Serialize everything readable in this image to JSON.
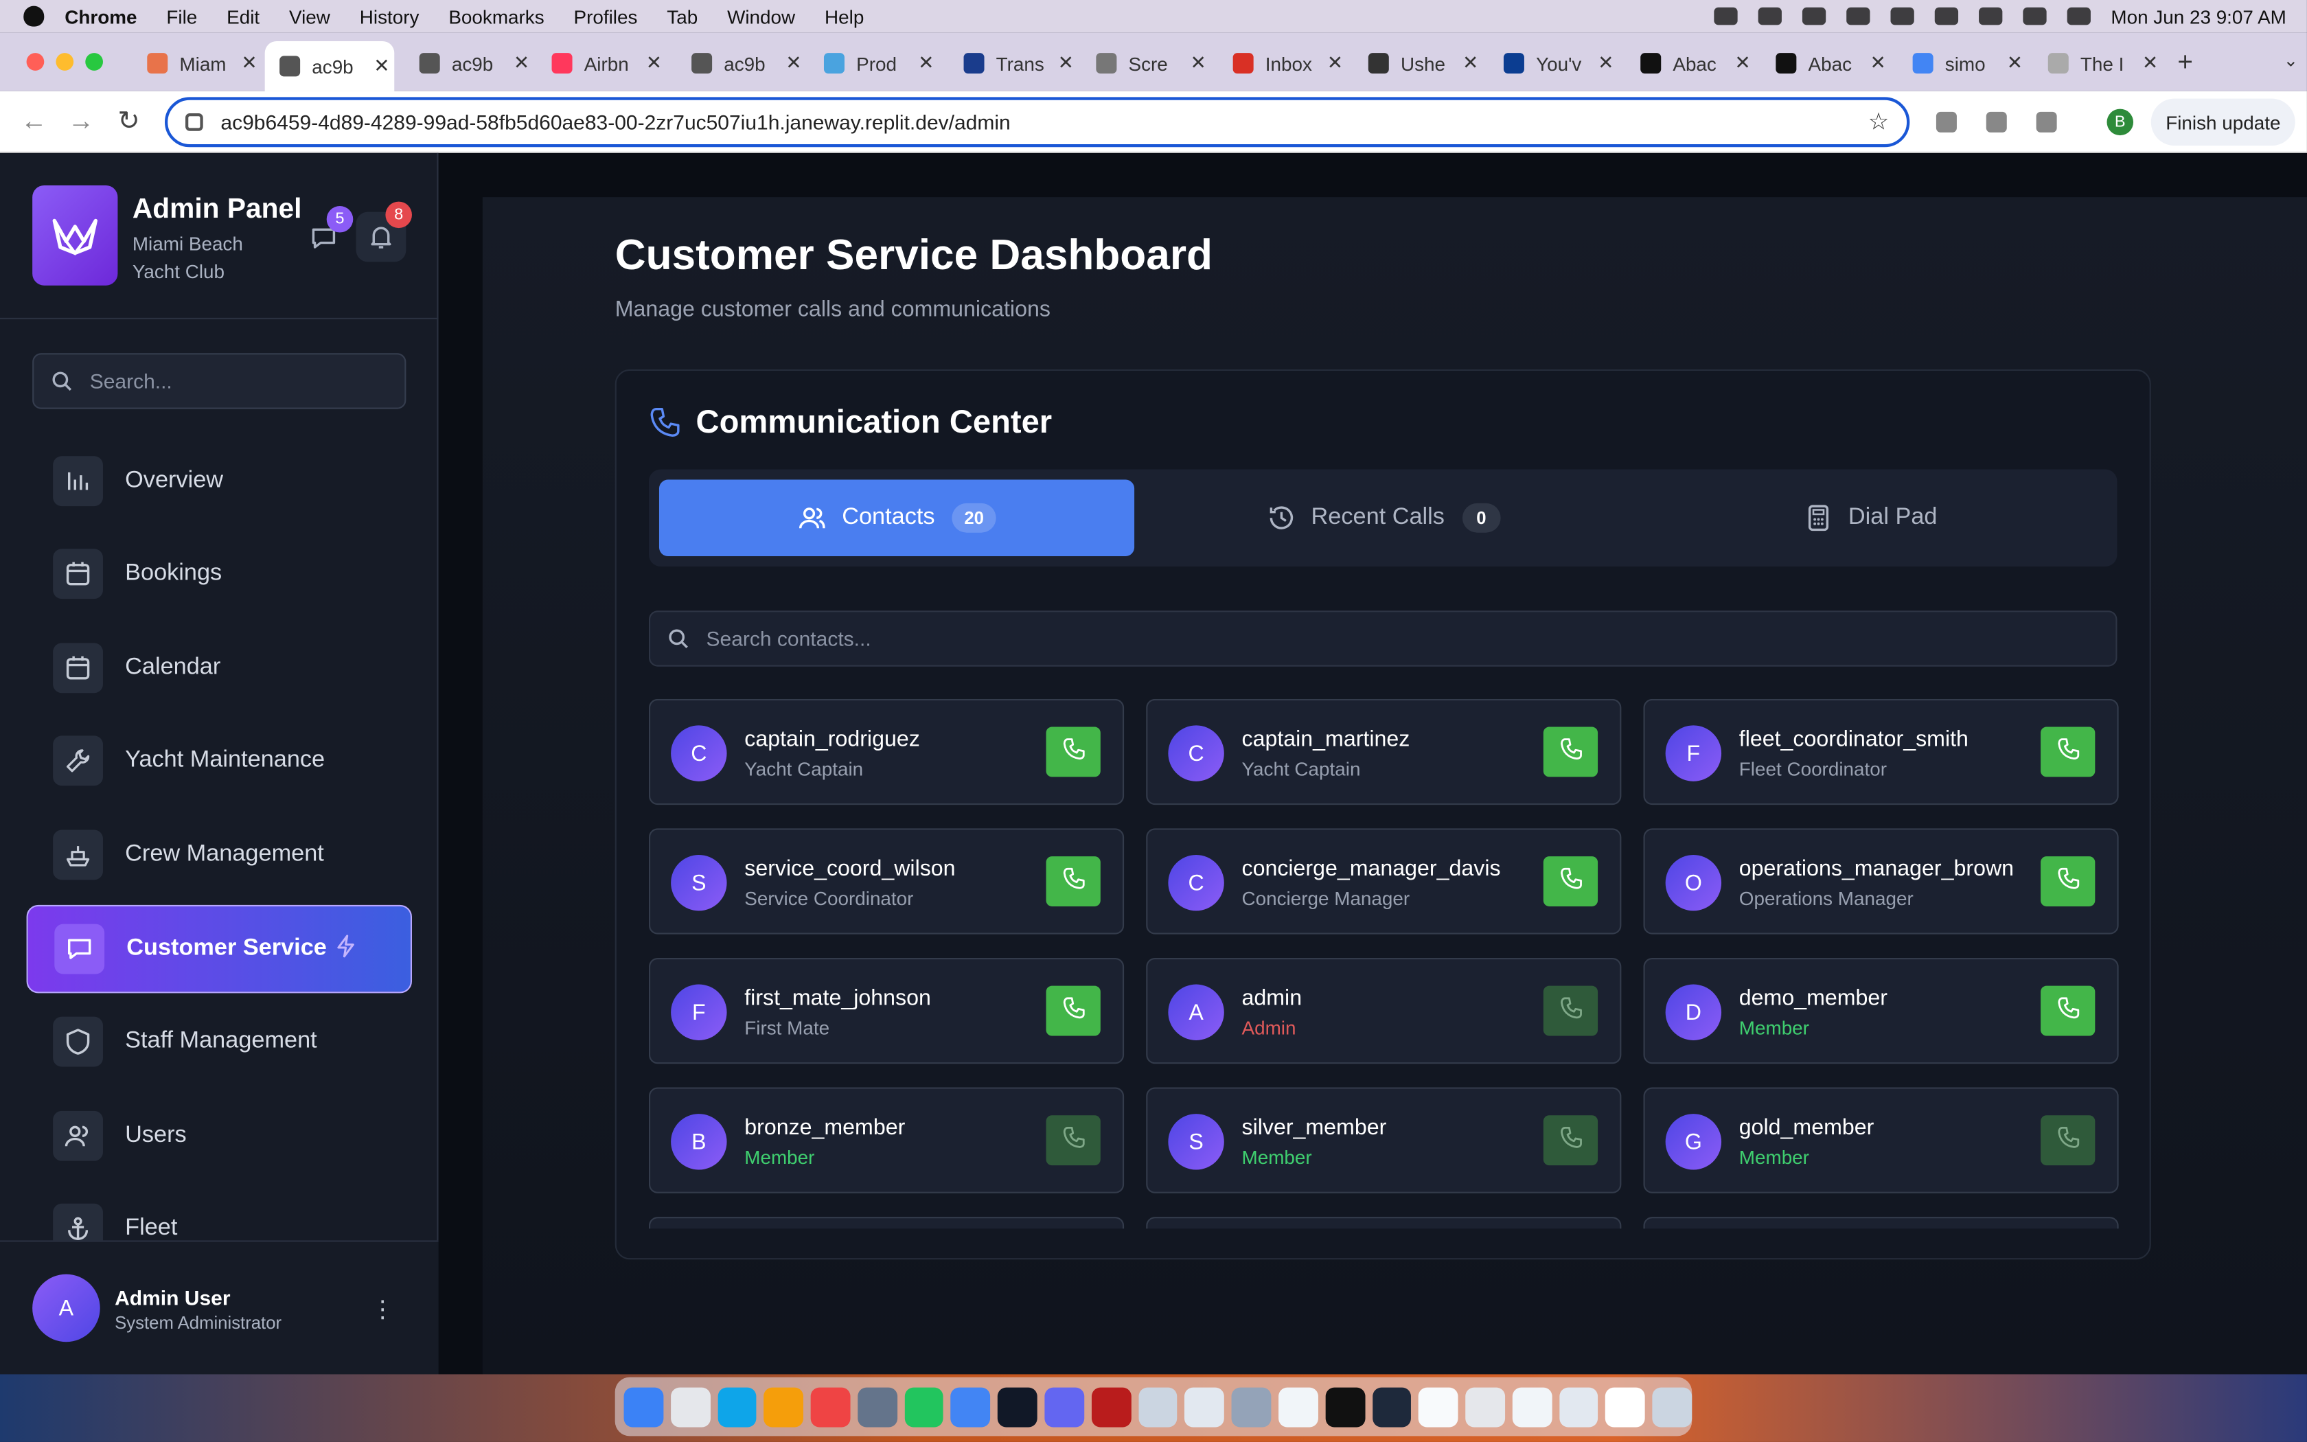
{
  "menubar": {
    "app": "Chrome",
    "items": [
      "File",
      "Edit",
      "View",
      "History",
      "Bookmarks",
      "Profiles",
      "Tab",
      "Window",
      "Help"
    ],
    "datetime": "Mon Jun 23  9:07 AM"
  },
  "browser": {
    "tabs": [
      {
        "label": "Miam",
        "color": "#e8734a"
      },
      {
        "label": "ac9b",
        "color": "#555555",
        "active": true
      },
      {
        "label": "ac9b",
        "color": "#555555"
      },
      {
        "label": "Airbn",
        "color": "#ff385c"
      },
      {
        "label": "ac9b",
        "color": "#555555"
      },
      {
        "label": "Prod",
        "color": "#4aa3df"
      },
      {
        "label": "Trans",
        "color": "#1a3c8c"
      },
      {
        "label": "Scre",
        "color": "#777777"
      },
      {
        "label": "Inbox",
        "color": "#d93025"
      },
      {
        "label": "Ushe",
        "color": "#333333"
      },
      {
        "label": "You'v",
        "color": "#0b3d91"
      },
      {
        "label": "Abac",
        "color": "#111111"
      },
      {
        "label": "Abac",
        "color": "#111111"
      },
      {
        "label": "simo",
        "color": "#4285f4"
      },
      {
        "label": "The I",
        "color": "#aaaaaa"
      }
    ],
    "url": "ac9b6459-4d89-4289-99ad-58fb5d60ae83-00-2zr7uc507iu1h.janeway.replit.dev/admin",
    "finish_update": "Finish update",
    "profile_initial": "B"
  },
  "sidebar": {
    "brand_title": "Admin Panel",
    "brand_sub": "Miami Beach Yacht Club",
    "messages_count": "5",
    "notifications_count": "8",
    "search_placeholder": "Search...",
    "items": [
      {
        "label": "Overview",
        "icon": "chart-bar-icon"
      },
      {
        "label": "Bookings",
        "icon": "calendar-icon"
      },
      {
        "label": "Calendar",
        "icon": "calendar-icon"
      },
      {
        "label": "Yacht Maintenance",
        "icon": "wrench-icon"
      },
      {
        "label": "Crew Management",
        "icon": "ship-icon"
      },
      {
        "label": "Customer Service",
        "icon": "message-square-icon",
        "active": true
      },
      {
        "label": "Staff Management",
        "icon": "shield-icon"
      },
      {
        "label": "Users",
        "icon": "users-icon"
      },
      {
        "label": "Fleet",
        "icon": "anchor-icon"
      }
    ],
    "user": {
      "initial": "A",
      "name": "Admin User",
      "role": "System Administrator"
    }
  },
  "main": {
    "title": "Customer Service Dashboard",
    "subtitle": "Manage customer calls and communications",
    "card_title": "Communication Center",
    "tabs": [
      {
        "label": "Contacts",
        "count": "20",
        "icon": "users-icon",
        "active": true
      },
      {
        "label": "Recent Calls",
        "count": "0",
        "icon": "history-icon"
      },
      {
        "label": "Dial Pad",
        "icon": "calculator-icon"
      }
    ],
    "contact_search_placeholder": "Search contacts...",
    "contacts": [
      {
        "initial": "C",
        "name": "captain_rodriguez",
        "role": "Yacht Captain",
        "role_type": "staff",
        "call_enabled": true
      },
      {
        "initial": "C",
        "name": "captain_martinez",
        "role": "Yacht Captain",
        "role_type": "staff",
        "call_enabled": true
      },
      {
        "initial": "F",
        "name": "fleet_coordinator_smith",
        "role": "Fleet Coordinator",
        "role_type": "staff",
        "call_enabled": true
      },
      {
        "initial": "S",
        "name": "service_coord_wilson",
        "role": "Service Coordinator",
        "role_type": "staff",
        "call_enabled": true
      },
      {
        "initial": "C",
        "name": "concierge_manager_davis",
        "role": "Concierge Manager",
        "role_type": "staff",
        "call_enabled": true
      },
      {
        "initial": "O",
        "name": "operations_manager_brown",
        "role": "Operations Manager",
        "role_type": "staff",
        "call_enabled": true
      },
      {
        "initial": "F",
        "name": "first_mate_johnson",
        "role": "First Mate",
        "role_type": "staff",
        "call_enabled": true
      },
      {
        "initial": "A",
        "name": "admin",
        "role": "Admin",
        "role_type": "admin",
        "call_enabled": false
      },
      {
        "initial": "D",
        "name": "demo_member",
        "role": "Member",
        "role_type": "member",
        "call_enabled": true
      },
      {
        "initial": "B",
        "name": "bronze_member",
        "role": "Member",
        "role_type": "member",
        "call_enabled": false
      },
      {
        "initial": "S",
        "name": "silver_member",
        "role": "Member",
        "role_type": "member",
        "call_enabled": false
      },
      {
        "initial": "G",
        "name": "gold_member",
        "role": "Member",
        "role_type": "member",
        "call_enabled": false
      }
    ]
  },
  "colors": {
    "accent_blue": "#4a7ef0",
    "active_nav_gradient": "#7c3aed",
    "call_green": "#43b649",
    "admin_red": "#e05a5a",
    "member_green": "#3fcf6f"
  }
}
